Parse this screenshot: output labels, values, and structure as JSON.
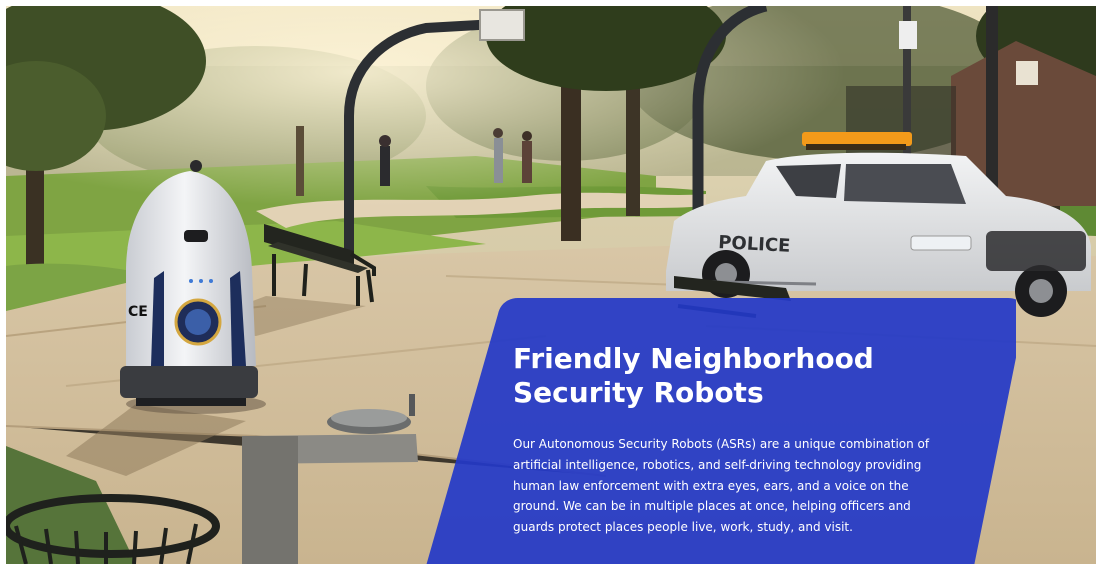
{
  "hero": {
    "image": {
      "alt": "Security robot patrolling a park next to a police car",
      "robot_panel_text": "CE",
      "car_door_text": "POLICE"
    },
    "title": "Friendly Neighborhood Security Robots",
    "description": "Our Autonomous Security Robots (ASRs) are a unique combination of artificial intelligence, robotics, and self-driving technology providing human law enforcement with extra eyes, ears, and a voice on the ground. We can be in multiple places at once, helping officers and guards protect places people live, work, study, and visit."
  },
  "colors": {
    "card_blue": "#2338c8",
    "text_white": "#ffffff",
    "light_bar_amber": "#f39a1a"
  }
}
